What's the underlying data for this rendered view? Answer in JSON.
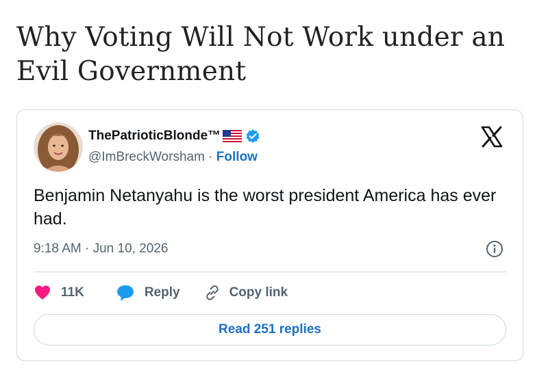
{
  "article": {
    "title": "Why Voting Will Not Work under an Evil Government"
  },
  "tweet": {
    "display_name": "ThePatrioticBlonde™",
    "handle": "@ImBreckWorsham",
    "separator": " · ",
    "follow_label": "Follow",
    "text": "Benjamin Netanyahu is the worst president America has ever had.",
    "timestamp": "9:18 AM · Jun 10, 2026",
    "actions": {
      "like_count": "11K",
      "reply_label": "Reply",
      "copy_label": "Copy link"
    },
    "read_replies_label": "Read 251 replies"
  },
  "icons": {
    "avatar": "avatar",
    "flag": "us-flag-icon",
    "verified": "verified-badge-icon",
    "platform": "x-logo-icon",
    "info": "info-icon",
    "like": "heart-icon",
    "reply": "speech-bubble-icon",
    "copy": "link-icon"
  },
  "colors": {
    "like": "#f91880",
    "reply": "#1d9bf0",
    "link": "#1d6fc4",
    "verified": "#1d9bf0",
    "muted": "#536471",
    "border": "#cfd9de"
  }
}
